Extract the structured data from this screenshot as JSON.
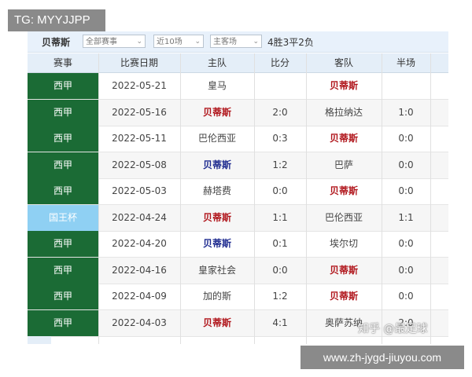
{
  "badges": {
    "top_left": "TG: MYYJJPP",
    "url": "www.zh-jygd-jiuyou.com"
  },
  "watermark": "知乎 @最足球",
  "filter": {
    "team": "贝蒂斯",
    "competition": "全部赛事",
    "range": "近10场",
    "venue": "主客场",
    "record": "4胜3平2负"
  },
  "table": {
    "headers": [
      "赛事",
      "比赛日期",
      "主队",
      "比分",
      "客队",
      "半场"
    ],
    "rows": [
      {
        "league": "西甲",
        "date": "2022-05-21",
        "home": "皇马",
        "score": "",
        "away": "贝蒂斯",
        "half": ""
      },
      {
        "league": "西甲",
        "date": "2022-05-16",
        "home": "贝蒂斯",
        "score": "2:0",
        "away": "格拉纳达",
        "half": "1:0"
      },
      {
        "league": "西甲",
        "date": "2022-05-11",
        "home": "巴伦西亚",
        "score": "0:3",
        "away": "贝蒂斯",
        "half": "0:0"
      },
      {
        "league": "西甲",
        "date": "2022-05-08",
        "home": "贝蒂斯",
        "score": "1:2",
        "away": "巴萨",
        "half": "0:0"
      },
      {
        "league": "西甲",
        "date": "2022-05-03",
        "home": "赫塔费",
        "score": "0:0",
        "away": "贝蒂斯",
        "half": "0:0"
      },
      {
        "league": "国王杯",
        "date": "2022-04-24",
        "home": "贝蒂斯",
        "score": "1:1",
        "away": "巴伦西亚",
        "half": "1:1"
      },
      {
        "league": "西甲",
        "date": "2022-04-20",
        "home": "贝蒂斯",
        "score": "0:1",
        "away": "埃尔切",
        "half": "0:0"
      },
      {
        "league": "西甲",
        "date": "2022-04-16",
        "home": "皇家社会",
        "score": "0:0",
        "away": "贝蒂斯",
        "half": "0:0"
      },
      {
        "league": "西甲",
        "date": "2022-04-09",
        "home": "加的斯",
        "score": "1:2",
        "away": "贝蒂斯",
        "half": "0:0"
      },
      {
        "league": "西甲",
        "date": "2022-04-03",
        "home": "贝蒂斯",
        "score": "4:1",
        "away": "奥萨苏纳",
        "half": "2:0"
      }
    ]
  },
  "colors": {
    "league_green": "#1b6b35",
    "cup_blue": "#8fd0f3",
    "team_red": "#b0151b",
    "team_blue": "#1d2a8f"
  }
}
